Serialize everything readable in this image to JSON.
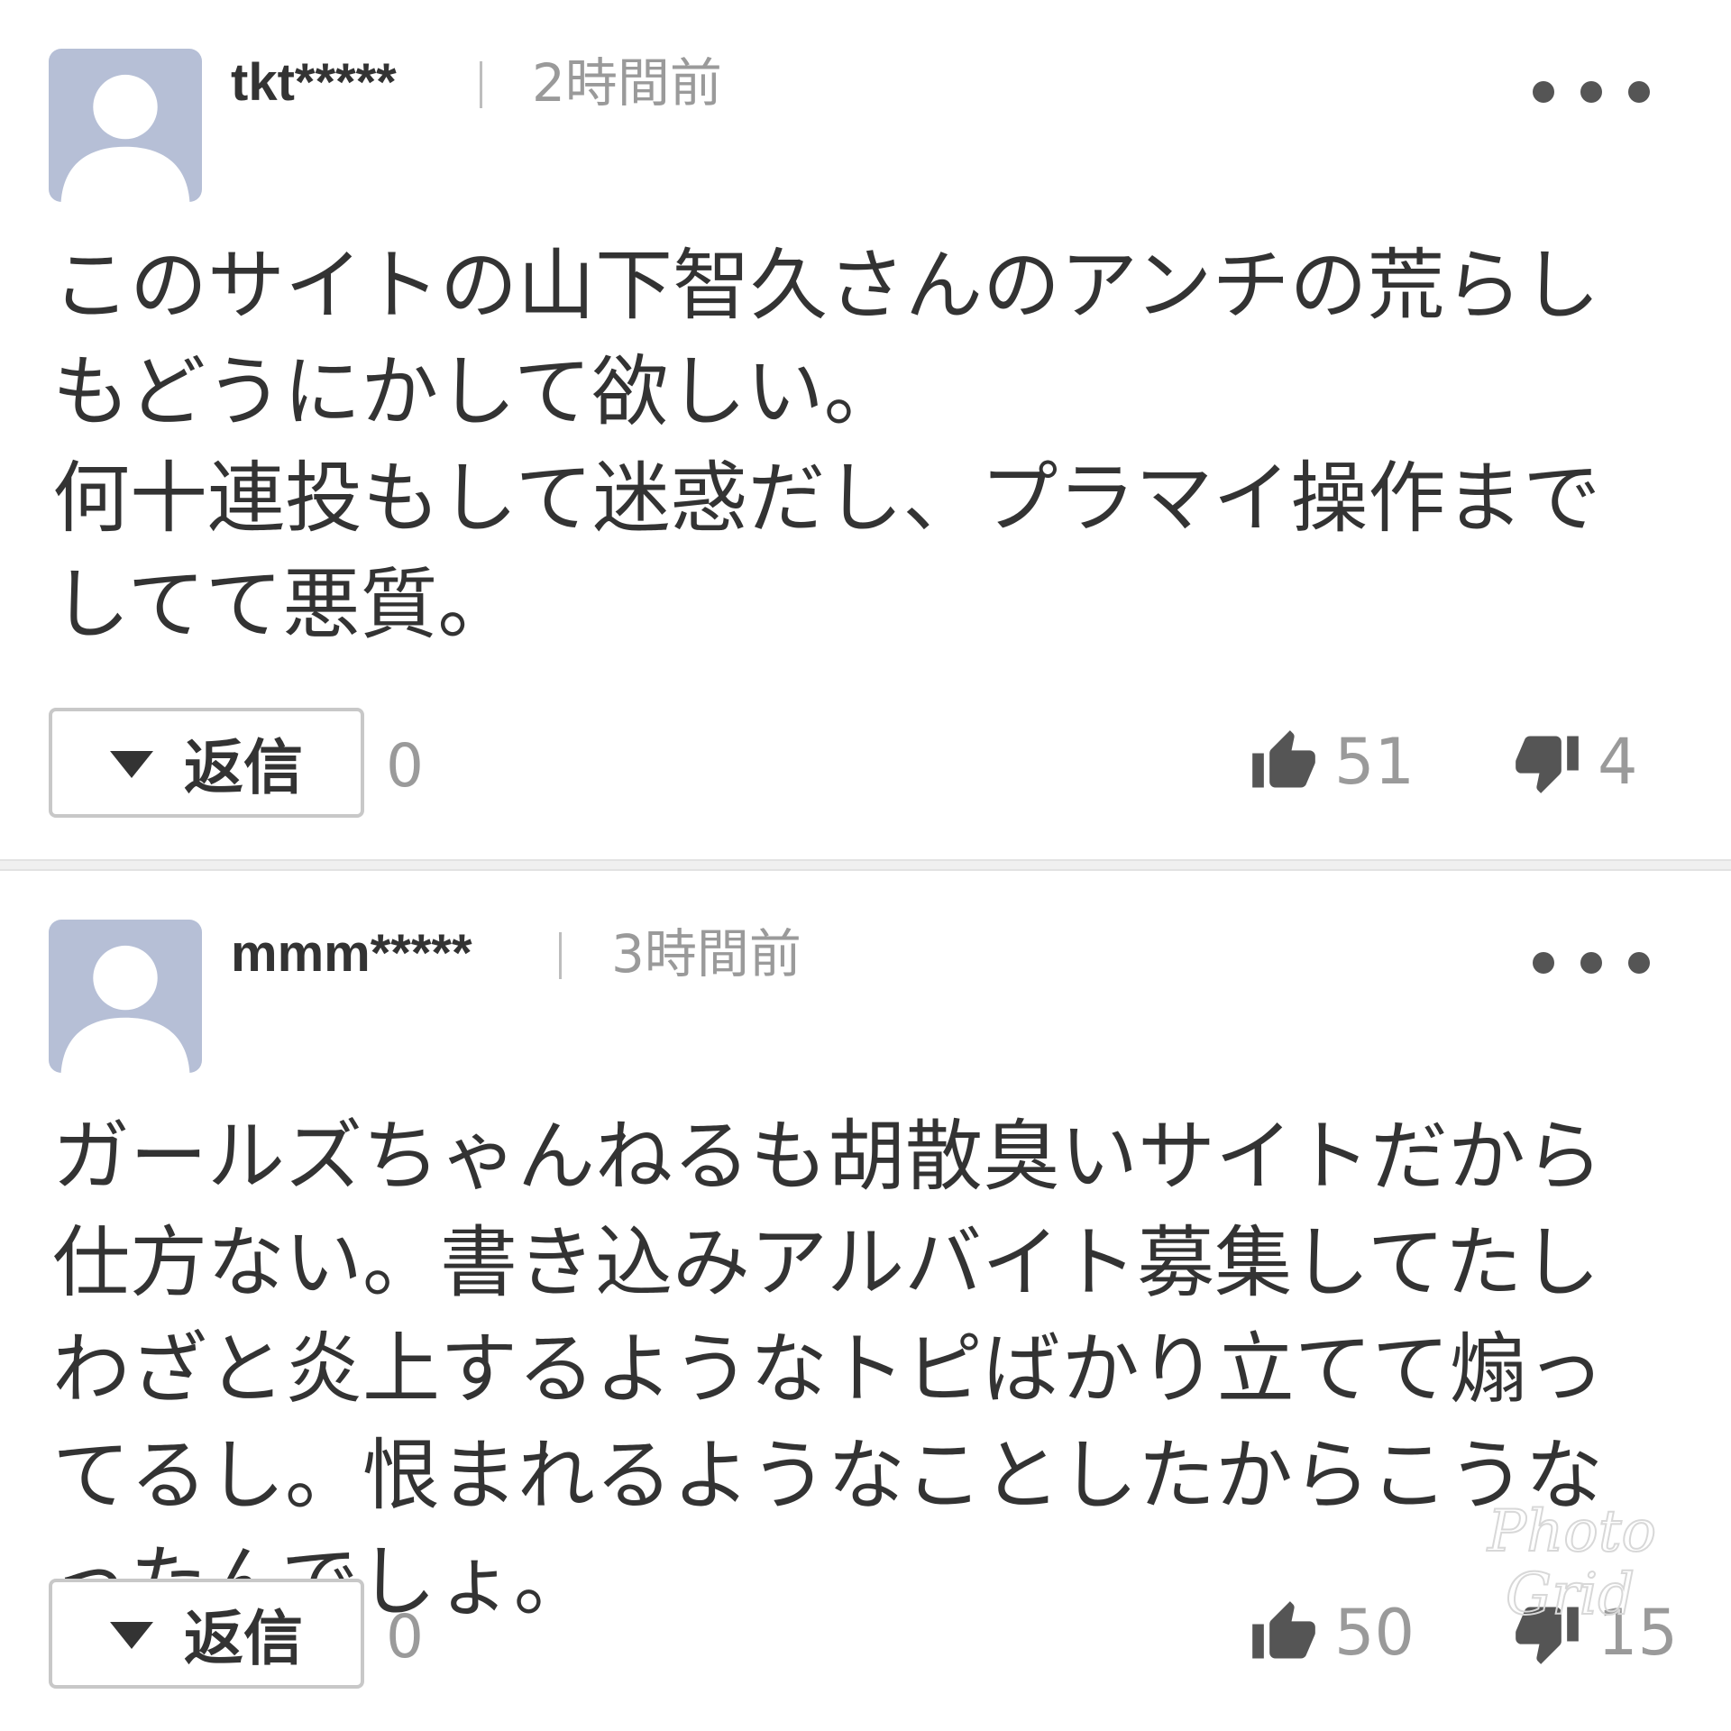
{
  "comments": [
    {
      "username": "tkt*****",
      "separator": "|",
      "time": "2時間前",
      "body": "このサイトの山下智久さんのアンチの荒らしもどうにかして欲しい。\n何十連投もして迷惑だし、プラマイ操作までしてて悪質。",
      "reply_label": "返信",
      "reply_count": "0",
      "likes": "51",
      "dislikes": "4"
    },
    {
      "username": "mmm*****",
      "separator": "|",
      "time": "3時間前",
      "body": "ガールズちゃんねるも胡散臭いサイトだから仕方ない。書き込みアルバイト募集してたしわざと炎上するようなトピばかり立てて煽ってるし。恨まれるようなことしたからこうなったんでしょ。",
      "reply_label": "返信",
      "reply_count": "0",
      "likes": "50",
      "dislikes": "15"
    }
  ],
  "icons": {
    "avatar": "default-user-avatar-icon",
    "more": "more-dots-icon",
    "reply_arrow": "caret-down-icon",
    "like": "thumbs-up-icon",
    "dislike": "thumbs-down-icon"
  },
  "colors": {
    "avatar_bg": "#b6bfd6",
    "text": "#333333",
    "muted": "#9a9a9a",
    "icon": "#555555"
  },
  "watermark": "PhotoGrid"
}
